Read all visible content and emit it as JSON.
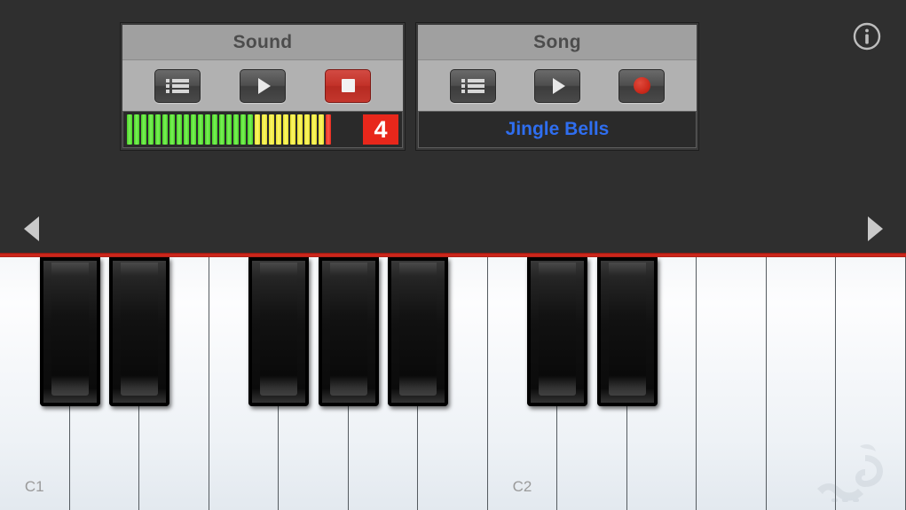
{
  "app": {
    "background_color": "#2f2f2f",
    "felt_color": "#d8291c"
  },
  "sound_panel": {
    "title": "Sound",
    "buttons": [
      {
        "name": "sound-list-button",
        "icon": "list-icon",
        "label": "Sound list"
      },
      {
        "name": "sound-play-button",
        "icon": "play-icon",
        "label": "Play sound"
      },
      {
        "name": "sound-stop-button",
        "icon": "stop-icon",
        "label": "Stop sound"
      }
    ],
    "vu_meter": {
      "green_segments": 18,
      "yellow_segments": 10,
      "red_segments": 1,
      "green_color": "#49d424",
      "yellow_color": "#e8e02a",
      "red_color": "#e82a1e"
    },
    "octave_badge": {
      "value": "4",
      "background_color": "#e8271b",
      "text_color": "#ffffff"
    }
  },
  "song_panel": {
    "title": "Song",
    "buttons": [
      {
        "name": "song-list-button",
        "icon": "list-icon",
        "label": "Song list"
      },
      {
        "name": "song-play-button",
        "icon": "play-icon",
        "label": "Play song"
      },
      {
        "name": "song-record-button",
        "icon": "record-icon",
        "label": "Record song"
      }
    ],
    "selected_song": "Jingle Bells",
    "selected_song_color": "#2f6ef0"
  },
  "header": {
    "info_icon": "info-icon"
  },
  "navigation": {
    "left_arrow": "chevron-left-icon",
    "right_arrow": "chevron-right-icon"
  },
  "keyboard": {
    "white_keys": [
      {
        "label": "C1"
      },
      {
        "label": ""
      },
      {
        "label": ""
      },
      {
        "label": ""
      },
      {
        "label": ""
      },
      {
        "label": ""
      },
      {
        "label": ""
      },
      {
        "label": "C2"
      },
      {
        "label": ""
      },
      {
        "label": ""
      },
      {
        "label": ""
      },
      {
        "label": ""
      },
      {
        "label": ""
      }
    ],
    "black_key_count": 7,
    "black_key_pattern": "2-3-2",
    "labels_visible": [
      "C1",
      "C2"
    ]
  }
}
